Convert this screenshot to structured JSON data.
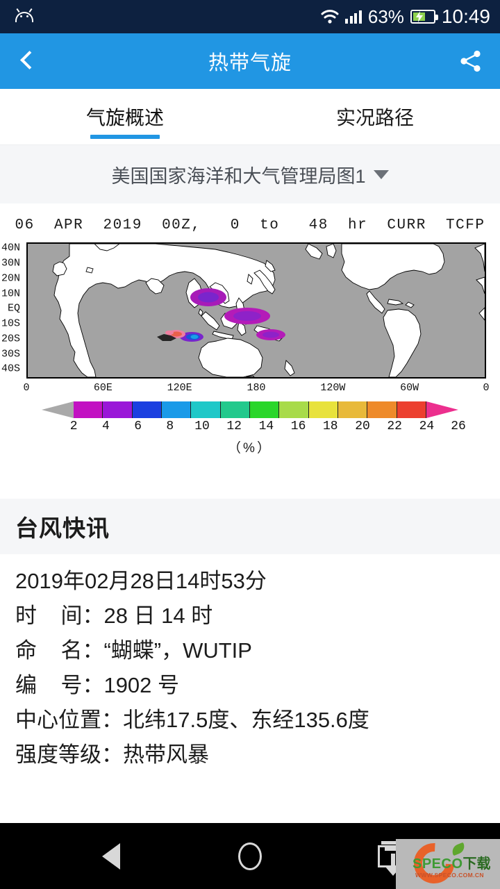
{
  "status_bar": {
    "android_icon": "android-robot-icon",
    "wifi_icon": "wifi-icon",
    "signal_icon": "cellular-signal-icon",
    "battery_percent": "63%",
    "battery_icon": "battery-charging-icon",
    "clock": "10:49",
    "bg_color": "#0d2140"
  },
  "app_bar": {
    "back_icon": "back-chevron-icon",
    "title": "热带气旋",
    "share_icon": "share-icon",
    "bg_color": "#2196e3"
  },
  "tabs": [
    {
      "label": "气旋概述",
      "active": true
    },
    {
      "label": "实况路径",
      "active": false
    }
  ],
  "selector": {
    "value": "美国国家海洋和大气管理局图1",
    "caret_icon": "chevron-down-icon",
    "bg_color": "#f5f6f8"
  },
  "chart_data": {
    "type": "heatmap",
    "title": "06  APR  2019  00Z,   0  to   48  hr  CURR  TCFP",
    "xlabel": "",
    "ylabel": "",
    "unit_label": "（%）",
    "grid": false,
    "legend_position": "bottom",
    "ocean_color": "#a3a3a3",
    "land_color": "#ffffff",
    "x_ticks": [
      "0",
      "60E",
      "120E",
      "180",
      "120W",
      "60W",
      "0"
    ],
    "x_tick_positions_pct": [
      0,
      16.67,
      33.33,
      50,
      66.67,
      83.33,
      100
    ],
    "y_ticks": [
      "40N",
      "30N",
      "20N",
      "10N",
      "EQ",
      "10S",
      "20S",
      "30S",
      "40S"
    ],
    "ylim": [
      -45,
      45
    ],
    "xlim": [
      0,
      360
    ],
    "colorbar": {
      "ticks": [
        2,
        4,
        6,
        8,
        10,
        12,
        14,
        16,
        18,
        20,
        22,
        24,
        26
      ],
      "colors": [
        "#c211c2",
        "#9a17d8",
        "#1b3fe0",
        "#1a9ae8",
        "#1fc8c8",
        "#22c98c",
        "#2ad62a",
        "#a8db4a",
        "#e8e23c",
        "#e8b93a",
        "#ee8a2a",
        "#ec3f2f",
        "#ec2f8e"
      ],
      "under_color": "#a9a9a9",
      "over_color": "#ec2f8e"
    },
    "features": [
      {
        "name": "blob-philippine-sea",
        "cx_pct": 39.5,
        "cy_pct": 40.0,
        "rx_pct": 4.0,
        "ry_pct": 7.0,
        "color": "#8a22c4",
        "value": 4
      },
      {
        "name": "blob-philippine-sea-core",
        "cx_pct": 39.5,
        "cy_pct": 40.0,
        "rx_pct": 2.1,
        "ry_pct": 4.2,
        "color": "#5a2fd0",
        "value": 5
      },
      {
        "name": "blob-new-guinea-north",
        "cx_pct": 48.0,
        "cy_pct": 54.0,
        "rx_pct": 5.0,
        "ry_pct": 6.5,
        "color": "#a71bb8",
        "value": 3
      },
      {
        "name": "blob-solomon-sea",
        "cx_pct": 53.0,
        "cy_pct": 68.0,
        "rx_pct": 3.2,
        "ry_pct": 4.0,
        "color": "#a71bb8",
        "value": 3
      },
      {
        "name": "blob-arafura-blue",
        "cx_pct": 35.7,
        "cy_pct": 70.0,
        "rx_pct": 2.6,
        "ry_pct": 3.4,
        "color": "#1b55d8",
        "value": 7
      },
      {
        "name": "blob-arafura-red",
        "cx_pct": 32.0,
        "cy_pct": 67.5,
        "rx_pct": 2.2,
        "ry_pct": 3.0,
        "color": "#e8604a",
        "value": 22
      },
      {
        "name": "blob-timor-pink",
        "cx_pct": 30.5,
        "cy_pct": 68.5,
        "rx_pct": 1.5,
        "ry_pct": 2.2,
        "color": "#ee7fa0",
        "value": 26
      }
    ]
  },
  "bulletin": {
    "heading": "台风快讯",
    "timestamp": "2019年02月28日14时53分",
    "lines": [
      "时    间：28 日 14 时",
      "命    名：“蝴蝶”，WUTIP",
      "编    号：1902 号",
      "中心位置：北纬17.5度、东经135.6度",
      "强度等级：热带风暴"
    ]
  },
  "nav_bar": {
    "back_icon": "nav-back-triangle-icon",
    "home_icon": "nav-home-circle-icon",
    "recent_icon": "nav-recents-square-icon",
    "download_icon": "download-arrow-icon",
    "bg_color": "#000000"
  },
  "watermark": {
    "brand": "SPECO",
    "suffix": "下载",
    "url": "WWW.SPECO.COM.CN",
    "brand_color": "#3f9b35",
    "ring_color": "#e8622a"
  }
}
